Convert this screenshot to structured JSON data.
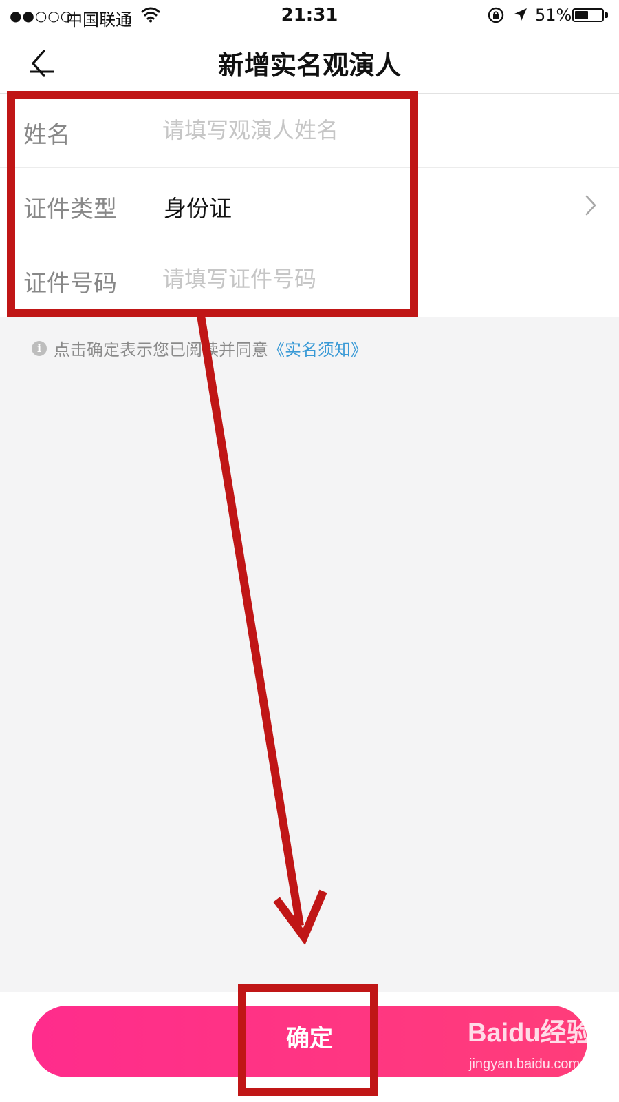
{
  "status_bar": {
    "signal": "●●○○○",
    "carrier": "中国联通",
    "time": "21:31",
    "battery_percent": "51%",
    "battery_level": 0.51,
    "icons": [
      "wifi-icon",
      "rotation-lock-icon",
      "location-arrow-icon",
      "battery-icon"
    ]
  },
  "nav": {
    "title": "新增实名观演人",
    "back_icon": "chevron-left-icon"
  },
  "form": {
    "name_label": "姓名",
    "name_placeholder": "请填写观演人姓名",
    "id_type_label": "证件类型",
    "id_type_value": "身份证",
    "id_number_label": "证件号码",
    "id_number_placeholder": "请填写证件号码"
  },
  "notice": {
    "icon": "info-icon",
    "text": "点击确定表示您已阅读并同意",
    "link": "《实名须知》",
    "link_color": "#3a9ad6"
  },
  "confirm_button": {
    "label": "确定",
    "color": "#ff2c8c"
  },
  "watermark": {
    "logo": "Baidu经验",
    "url": "jingyan.baidu.com"
  },
  "annotation_color": "#c01616"
}
